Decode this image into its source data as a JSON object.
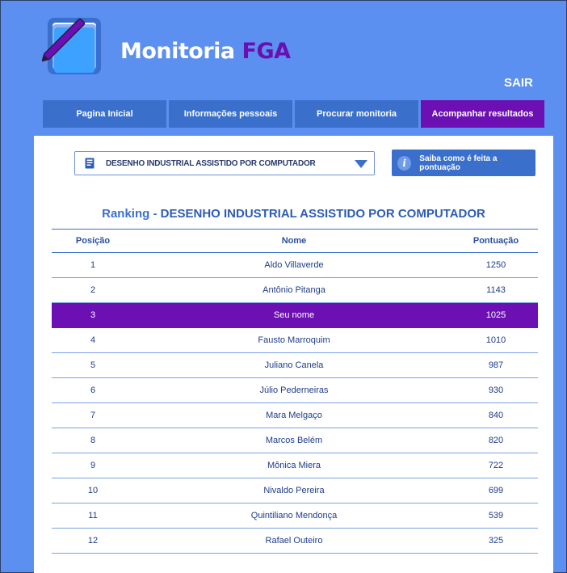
{
  "header": {
    "title_main": "Monitoria",
    "title_accent": "FGA",
    "logout_label": "SAIR",
    "logo_icon": "notebook-pen-logo-icon"
  },
  "nav": {
    "tabs": [
      {
        "label": "Pagina Inicial",
        "active": false
      },
      {
        "label": "Informações pessoais",
        "active": false
      },
      {
        "label": "Procurar monitoria",
        "active": false
      },
      {
        "label": "Acompanhar resultados",
        "active": true
      }
    ]
  },
  "filter": {
    "selected_course": "DESENHO INDUSTRIAL ASSISTIDO POR COMPUTADOR",
    "book_icon": "book-icon",
    "caret_icon": "chevron-down-icon",
    "info_button_label": "Saiba como é feita a pontuação",
    "info_icon": "info-icon"
  },
  "ranking": {
    "title_prefix": "Ranking",
    "title_sep": "-",
    "title_course": "DESENHO INDUSTRIAL ASSISTIDO POR COMPUTADOR",
    "columns": [
      "Posição",
      "Nome",
      "Pontuação"
    ],
    "rows": [
      {
        "pos": "1",
        "name": "Aldo Villaverde",
        "score": "1250"
      },
      {
        "pos": "2",
        "name": "Antônio Pitanga",
        "score": "1143"
      },
      {
        "pos": "3",
        "name": "Seu nome",
        "score": "1025",
        "highlight": true
      },
      {
        "pos": "4",
        "name": "Fausto Marroquim",
        "score": "1010"
      },
      {
        "pos": "5",
        "name": "Juliano Canela",
        "score": "987"
      },
      {
        "pos": "6",
        "name": "Júlio Pederneiras",
        "score": "930"
      },
      {
        "pos": "7",
        "name": "Mara Melgaço",
        "score": "840"
      },
      {
        "pos": "8",
        "name": "Marcos Belém",
        "score": "820"
      },
      {
        "pos": "9",
        "name": "Mônica Miera",
        "score": "722"
      },
      {
        "pos": "10",
        "name": "Nivaldo Pereira",
        "score": "699"
      },
      {
        "pos": "11",
        "name": "Quintiliano Mendonça",
        "score": "539"
      },
      {
        "pos": "12",
        "name": "Rafael Outeiro",
        "score": "325"
      }
    ]
  },
  "colors": {
    "background": "#5b8ff0",
    "nav": "#3a70cc",
    "accent_purple": "#6c0fb3",
    "text_blue": "#1f3c8a"
  }
}
